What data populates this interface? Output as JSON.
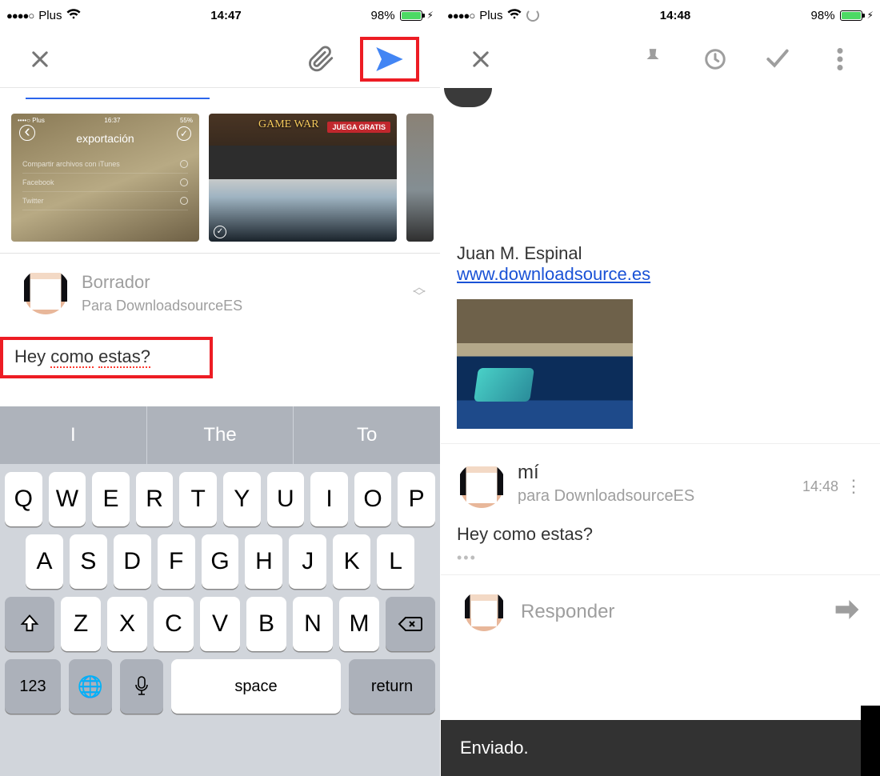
{
  "left": {
    "status": {
      "carrier": "Plus",
      "signal": "●●●●○",
      "time": "14:47",
      "battery_pct": "98%"
    },
    "thumb1": {
      "sb_left": "••••○ Plus",
      "sb_time": "16:37",
      "sb_batt": "55%",
      "title": "exportación",
      "rows": [
        "Compartir archivos con iTunes",
        "Facebook",
        "Twitter"
      ]
    },
    "thumb2": {
      "game": "GAME WAR",
      "cta": "JUEGA GRATIS"
    },
    "draft": {
      "title": "Borrador",
      "to": "Para DownloadsourceES"
    },
    "message": {
      "w1": "Hey",
      "w2": "como",
      "w3": "estas?"
    },
    "suggestions": [
      "I",
      "The",
      "To"
    ],
    "kbd": {
      "row1": [
        "Q",
        "W",
        "E",
        "R",
        "T",
        "Y",
        "U",
        "I",
        "O",
        "P"
      ],
      "row2": [
        "A",
        "S",
        "D",
        "F",
        "G",
        "H",
        "J",
        "K",
        "L"
      ],
      "row3": [
        "Z",
        "X",
        "C",
        "V",
        "B",
        "N",
        "M"
      ],
      "num": "123",
      "space": "space",
      "return": "return"
    }
  },
  "right": {
    "status": {
      "carrier": "Plus",
      "signal": "●●●●○",
      "time": "14:48",
      "battery_pct": "98%"
    },
    "signature": {
      "name": "Juan M. Espinal",
      "url": "www.downloadsource.es"
    },
    "msg": {
      "from": "mí",
      "to": "para DownloadsourceES",
      "time": "14:48",
      "body": "Hey como estas?"
    },
    "reply_label": "Responder",
    "toast": "Enviado."
  }
}
